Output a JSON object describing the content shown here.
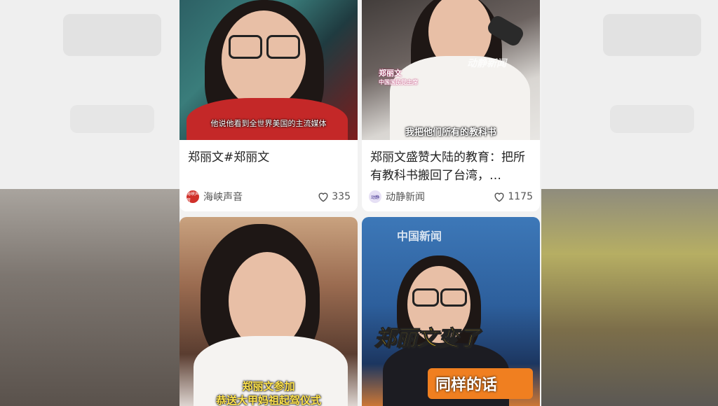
{
  "cards": [
    {
      "subtitle": "他说他看到全世界美国的主流媒体",
      "title": "郑丽文#郑丽文",
      "author": "海峡声音",
      "avatar_text": "海峡声音",
      "avatar_color": "#d0302a",
      "likes": "335",
      "icon": "heart-icon"
    },
    {
      "watermark": "动静新闻",
      "name_tag_line1": "郑丽文",
      "name_tag_line2": "中国国民党主席",
      "subtitle": "我把他们所有的教科书",
      "title": "郑丽文盛赞大陆的教育：把所有教科书搬回了台湾，…",
      "author": "动静新闻",
      "avatar_text": "动静",
      "avatar_color": "#e6e0f5",
      "likes": "1175",
      "icon": "heart-icon"
    },
    {
      "caption_line1": "郑丽文参加",
      "caption_line2": "恭送大甲妈祖起驾仪式"
    },
    {
      "banner": "中国新闻",
      "caption_top": "郑丽文变了",
      "caption_bottom": "同样的话"
    }
  ]
}
